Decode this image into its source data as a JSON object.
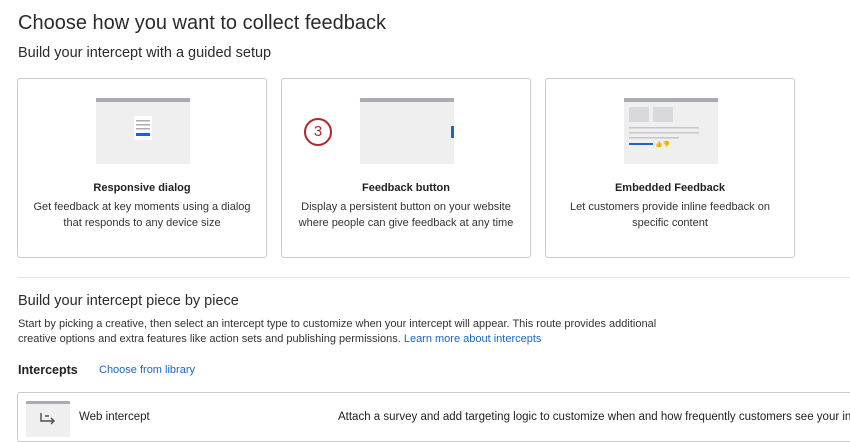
{
  "header": {
    "title": "Choose how you want to collect feedback",
    "guided_subtitle": "Build your intercept with a guided setup"
  },
  "guided_cards": [
    {
      "title": "Responsive dialog",
      "description": "Get feedback at key moments using a dialog that responds to any device size"
    },
    {
      "title": "Feedback button",
      "description": "Display a persistent button on your website where people can give feedback at any time",
      "step_badge": "3"
    },
    {
      "title": "Embedded Feedback",
      "description": "Let customers provide inline feedback on specific content"
    }
  ],
  "piece_section": {
    "title": "Build your intercept piece by piece",
    "description": "Start by picking a creative, then select an intercept type to customize when your intercept will appear. This route provides additional creative options and extra features like action sets and publishing permissions.",
    "learn_more_link": "Learn more about intercepts"
  },
  "intercepts": {
    "label": "Intercepts",
    "library_link": "Choose from library",
    "items": [
      {
        "name": "Web intercept",
        "description": "Attach a survey and add targeting logic to customize when and how frequently customers see your intercept"
      }
    ]
  },
  "colors": {
    "accent_blue": "#1a66c8",
    "step_badge_red": "#b3262d",
    "card_border": "#c9cbcf"
  }
}
